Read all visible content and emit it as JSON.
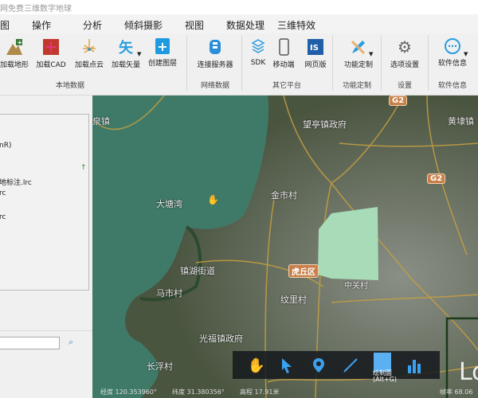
{
  "title": "网免费三维数字地球",
  "menu": [
    "图",
    "操作",
    "分析",
    "倾斜摄影",
    "视图",
    "数据处理",
    "三维特效"
  ],
  "ribbon": {
    "items": [
      {
        "label": "加载地形",
        "icon": "terrain-icon"
      },
      {
        "label": "加载CAD",
        "icon": "cad-icon"
      },
      {
        "label": "加载点云",
        "icon": "point-cloud-icon"
      },
      {
        "label": "加载矢量",
        "icon": "vector-icon",
        "glyph": "矢"
      },
      {
        "label": "创建图层",
        "icon": "create-layer-icon",
        "glyph": "+"
      },
      {
        "label": "连接服务器",
        "icon": "server-icon"
      },
      {
        "label": "SDK",
        "icon": "sdk-icon"
      },
      {
        "label": "移动端",
        "icon": "mobile-icon"
      },
      {
        "label": "网页版",
        "icon": "web-icon"
      },
      {
        "label": "功能定制",
        "icon": "pencil-icon"
      },
      {
        "label": "选项设置",
        "icon": "gear-icon",
        "glyph": "⚙"
      },
      {
        "label": "软件信息",
        "icon": "info-icon",
        "glyph": "⋯"
      }
    ],
    "groups": [
      "本地数据",
      "网络数据",
      "其它平台",
      "功能定制",
      "设置",
      "软件信息"
    ]
  },
  "left_panel": {
    "tree": [
      "nR)",
      "地标注.lrc",
      "rc",
      "rc"
    ],
    "search_value": ""
  },
  "map": {
    "labels": [
      "泉镇",
      "望亭镇政府",
      "黄埭镇",
      "大塘湾",
      "金市村",
      "镇湖街道",
      "马市村",
      "纹里村",
      "光福镇政府",
      "长浮村",
      "中关村"
    ],
    "badges": [
      "G2",
      "G2",
      "虎丘区"
    ],
    "overlay_text": "Lo",
    "polygon_color": "#a8dcb8"
  },
  "toolbar": {
    "tooltip": "绘制面",
    "tooltip_shortcut": "(Alt+G)"
  },
  "status": {
    "lon_label": "经度",
    "lon": "120.353960°",
    "lat_label": "纬度",
    "lat": "31.380356°",
    "alt_label": "高程",
    "alt": "17.91米",
    "fps_label": "帧率",
    "fps": "68.06"
  }
}
